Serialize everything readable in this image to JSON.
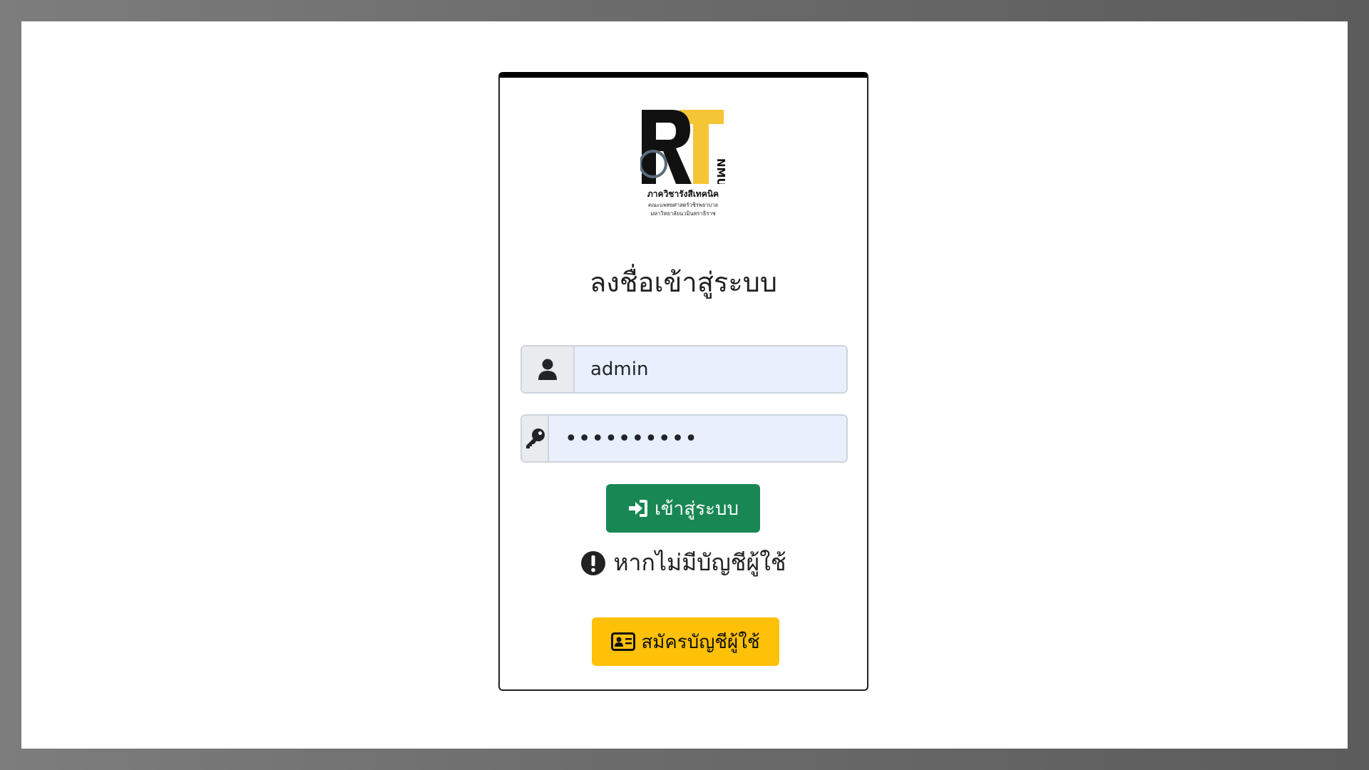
{
  "logo": {
    "emblem_text": "RT",
    "emblem_side_text": "NMU",
    "org_name": "ภาควิชารังสีเทคนิค",
    "org_sub_1": "คณะแพทยศาสตร์วชิรพยาบาล",
    "org_sub_2": "มหาวิทยาลัยนวมินทราธิราช",
    "colors": {
      "dark": "#111111",
      "gold": "#f4c534"
    }
  },
  "login": {
    "title": "ลงชื่อเข้าสู่ระบบ",
    "username": {
      "icon": "user-icon",
      "value": "admin"
    },
    "password": {
      "icon": "key-icon",
      "value": "••••••••••"
    },
    "submit_label": "เข้าสู่ระบบ",
    "submit_icon": "sign-in-icon",
    "notice_icon": "exclamation-circle-icon",
    "notice_text": "หากไม่มีบัญชีผู้ใช้",
    "register_label": "สมัครบัญชีผู้ใช้",
    "register_icon": "id-card-icon"
  },
  "colors": {
    "success": "#198754",
    "warning": "#ffc107",
    "input_bg": "#e8f0fe"
  }
}
